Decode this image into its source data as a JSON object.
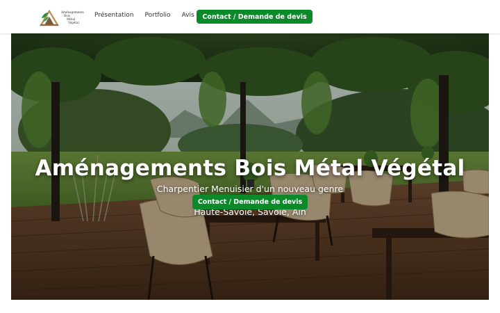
{
  "header": {
    "logo": {
      "lines": [
        "Aménagements",
        "Bois",
        "Métal",
        "Végétal"
      ]
    },
    "nav": [
      {
        "label": "Présentation"
      },
      {
        "label": "Portfolio"
      },
      {
        "label": "Avis"
      }
    ],
    "cta_label": "Contact / Demande de devis"
  },
  "hero": {
    "title": "Aménagements Bois Métal Végétal",
    "subtitle": "Charpentier Menuisier d'un nouveau genre",
    "location": "Haute-Savoie, Savoie, Ain",
    "cta_label": "Contact / Demande de devis"
  },
  "colors": {
    "accent": "#0b8a2a",
    "deck": "#7a4a2a",
    "foliage": "#3f6b2a"
  }
}
